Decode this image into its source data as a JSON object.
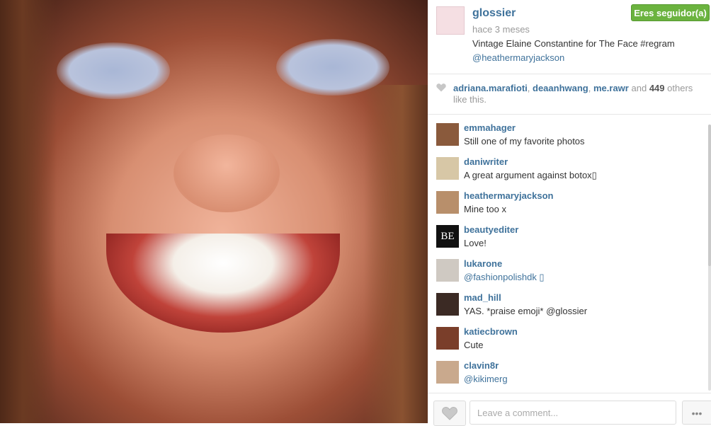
{
  "post": {
    "username": "glossier",
    "time": "hace 3 meses",
    "caption": "Vintage Elaine Constantine for The Face #regram",
    "mention": "@heathermaryjackson",
    "follow_label": "Eres seguidor(a)"
  },
  "likes": {
    "users": [
      "adriana.marafioti",
      "deaanhwang",
      "me.rawr"
    ],
    "and_word": "and",
    "count": "449",
    "suffix": "others like this."
  },
  "comments": [
    {
      "user": "emmahager",
      "text": "Still one of my favorite photos",
      "avatar_color": "#8a5a3c"
    },
    {
      "user": "daniwriter",
      "text": "A great argument against botox▯",
      "avatar_color": "#d7c7a6"
    },
    {
      "user": "heathermaryjackson",
      "text": "Mine too x",
      "avatar_color": "#b88f6b"
    },
    {
      "user": "beautyediter",
      "text": "Love!",
      "avatar_color": "#111111",
      "avatar_text": "BE"
    },
    {
      "user": "lukarone",
      "text": "@fashionpolishdk ▯",
      "avatar_color": "#cfc9c2"
    },
    {
      "user": "mad_hill",
      "text": "YAS. *praise emoji* @glossier",
      "avatar_color": "#3b2a24"
    },
    {
      "user": "katiecbrown",
      "text": "Cute",
      "avatar_color": "#7a3e2a"
    },
    {
      "user": "clavin8r",
      "text": "@kikimerg",
      "avatar_color": "#c9a98d"
    }
  ],
  "footer": {
    "placeholder": "Leave a comment...",
    "more_label": "•••"
  },
  "colors": {
    "link": "#3f729b",
    "follow": "#6bb33f"
  },
  "icons": [
    "heart-icon",
    "heart-outline-icon",
    "ellipsis-icon"
  ]
}
